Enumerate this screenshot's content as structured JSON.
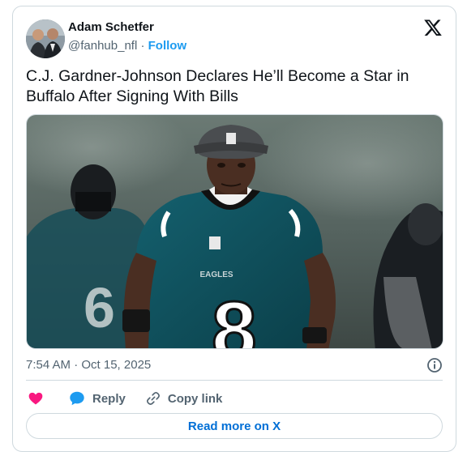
{
  "author": {
    "name": "Adam Schetfer",
    "handle": "@fanhub_nfl",
    "separator": "·",
    "follow_label": "Follow"
  },
  "tweet": {
    "text": "C.J. Gardner-Johnson Declares He’ll Become a Star in Buffalo After Signing With Bills",
    "timestamp": "7:54 AM · Oct 15, 2025"
  },
  "media": {
    "jersey_text": "EAGLES",
    "jersey_number": "8",
    "background_jersey_number": "6"
  },
  "actions": {
    "reply_label": "Reply",
    "copy_link_label": "Copy link"
  },
  "read_more_label": "Read more on X",
  "colors": {
    "accent": "#1d9bf0",
    "link": "#006fd6",
    "like": "#f91880",
    "jersey": "#0e4c58",
    "muted": "#536471",
    "border": "#cfd9de"
  },
  "icons": [
    "x-logo-icon",
    "info-icon",
    "heart-icon",
    "reply-bubble-icon",
    "link-icon"
  ]
}
